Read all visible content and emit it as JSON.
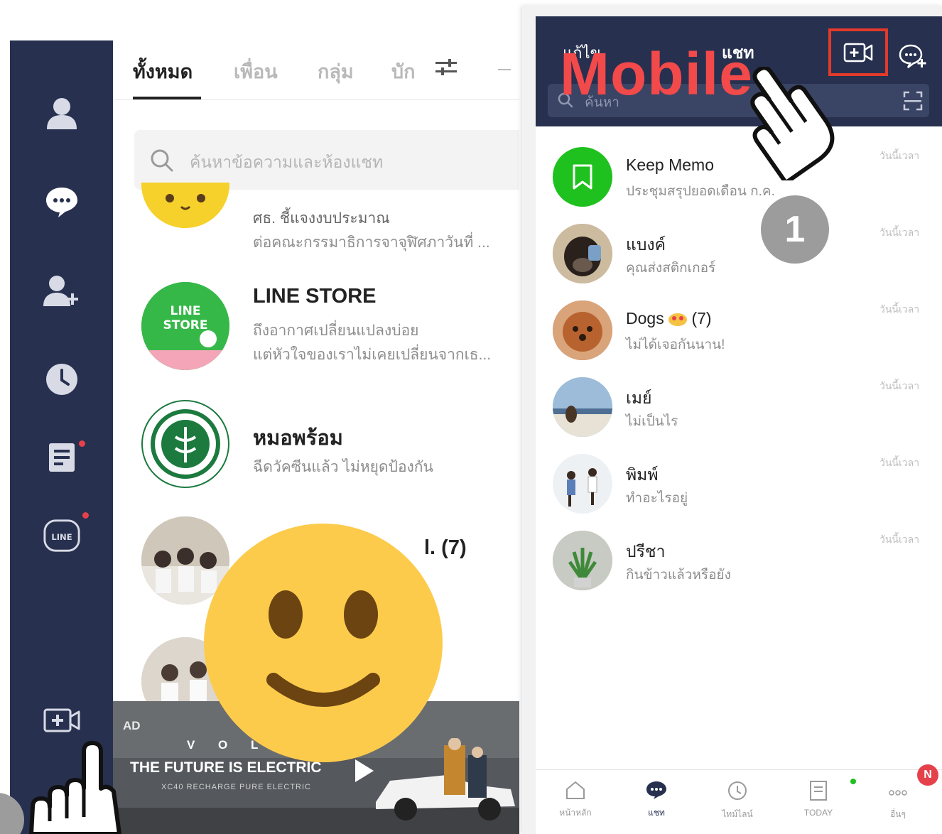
{
  "desktop": {
    "tabs": [
      {
        "label": "ทั้งหมด",
        "active": true
      },
      {
        "label": "เพื่อน",
        "active": false
      },
      {
        "label": "กลุ่ม",
        "active": false
      },
      {
        "label": "บัก",
        "active": false
      }
    ],
    "search_placeholder": "ค้นหาข้อความและห้องแชท",
    "chats": [
      {
        "name": "",
        "line1": "ศธ. ชี้แจงงบประมาณ",
        "line2": "ต่อคณะกรรมาธิการจาจุฬิศภาวันที่ ..."
      },
      {
        "name": "LINE STORE",
        "line1": "ถึงอากาศเปลี่ยนแปลงบ่อย",
        "line2": "แต่หัวใจของเราไม่เคยเปลี่ยนจากเธ...",
        "avatar_text": "LINE STORE"
      },
      {
        "name": "หมอพร้อม",
        "line1": "ฉีดวัคซีนแล้ว ไม่หยุดป้องกัน"
      },
      {
        "name": "",
        "name_tail": "l. (7)"
      },
      {
        "name": ""
      }
    ],
    "ad": {
      "badge": "AD",
      "brand": "V O L",
      "headline": "THE FUTURE IS ELECTRIC",
      "subline": "XC40 RECHARGE PURE ELECTRIC"
    },
    "sidebar_icons": [
      "person-icon",
      "chat-icon",
      "add-friend-icon",
      "clock-icon",
      "note-icon",
      "line-icon",
      "video-call-icon"
    ]
  },
  "mobile": {
    "header": {
      "edit": "แก้ไข",
      "title": "แชท",
      "search_placeholder": "ค้นหา"
    },
    "chats": [
      {
        "name": "Keep Memo",
        "message": "ประชุมสรุปยอดเดือน ก.ค.",
        "time": "วันนี้เวลา"
      },
      {
        "name": "แบงค์",
        "message": "คุณส่งสติกเกอร์",
        "time": "วันนี้เวลา"
      },
      {
        "name": "Dogs",
        "count": "(7)",
        "message": "ไม่ได้เจอกันนาน!",
        "time": "วันนี้เวลา"
      },
      {
        "name": "เมย์",
        "message": "ไม่เป็นไร",
        "time": "วันนี้เวลา"
      },
      {
        "name": "พิมพ์",
        "message": "ทำอะไรอยู่",
        "time": "วันนี้เวลา"
      },
      {
        "name": "ปรีชา",
        "message": "กินข้าวแล้วหรือยัง",
        "time": "วันนี้เวลา"
      }
    ],
    "nav": [
      {
        "label": "หน้าหลัก",
        "icon": "home-icon"
      },
      {
        "label": "แชท",
        "icon": "chat-icon"
      },
      {
        "label": "ไทม์ไลน์",
        "icon": "clock-icon"
      },
      {
        "label": "TODAY",
        "icon": "news-icon"
      },
      {
        "label": "อื่นๆ",
        "icon": "more-icon",
        "badge": "N"
      }
    ]
  },
  "overlay": {
    "mobile_label": "Mobile",
    "step": "1"
  },
  "colors": {
    "navy": "#27304f",
    "line_green": "#1ec11e",
    "highlight_red": "#e23a2a",
    "label_red": "#f2494a"
  }
}
